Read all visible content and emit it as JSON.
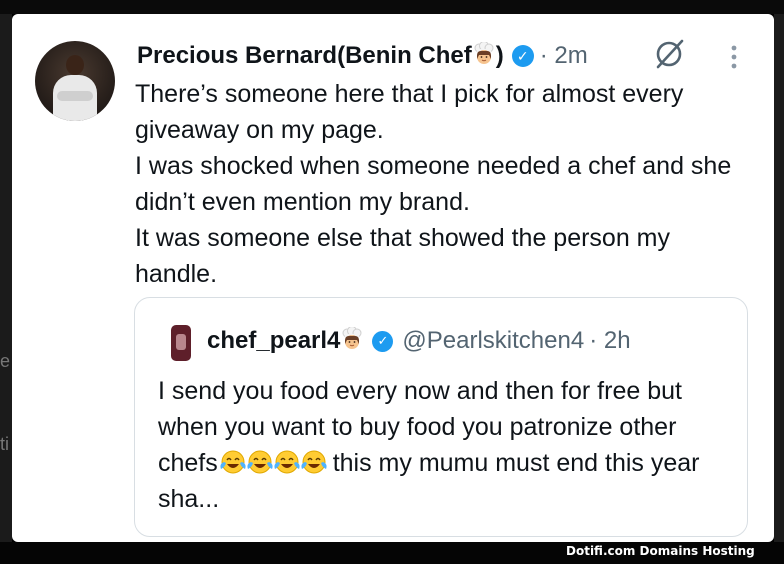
{
  "tweet": {
    "author_name": "Precious Bernard(Benin Chef",
    "author_name_suffix": ")",
    "verified_mark": "✓",
    "time_ago": "· 2m",
    "avatar_icon": "user-avatar-chef",
    "more_icon": "more-vertical-icon",
    "grok_icon": "slash-circle-icon",
    "paragraphs": [
      "There’s someone here that I pick for almost every giveaway on my page.",
      "I was shocked when someone needed a chef and she didn’t even mention my brand.",
      "It was someone else that showed the person my handle."
    ]
  },
  "quoted_tweet": {
    "author_name": "chef_pearl4",
    "verified_mark": "✓",
    "handle": "@Pearlskitchen4",
    "time_ago": "· 2h",
    "text_line1": "I send you food every now and then for free but when you want to buy food you patronize other chefs",
    "text_line2": " this my mumu must end this year sha..."
  },
  "edge_fragments": {
    "top": "e",
    "bottom": "ti"
  },
  "watermark": "Dotifi.com Domains Hosting",
  "colors": {
    "accent": "#1d9bf0",
    "text": "#0f1419",
    "secondary_text": "#536471",
    "border": "#d8dee3"
  }
}
